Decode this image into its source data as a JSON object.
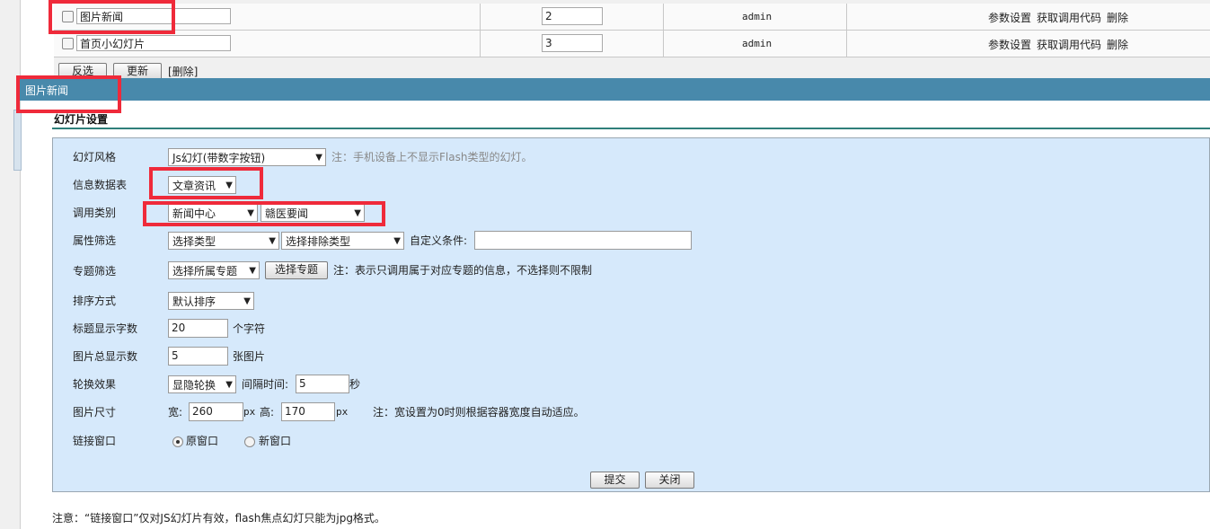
{
  "top_table": {
    "rows": [
      {
        "name": "图片新闻",
        "order": "2",
        "author": "admin",
        "actions": [
          "参数设置",
          "获取调用代码",
          "删除"
        ]
      },
      {
        "name": "首页小幻灯片",
        "order": "3",
        "author": "admin",
        "actions": [
          "参数设置",
          "获取调用代码",
          "删除"
        ]
      }
    ],
    "buttons": {
      "invert": "反选",
      "update": "更新",
      "delete": "[删除]"
    }
  },
  "header_band": {
    "title": "图片新闻"
  },
  "section": {
    "title": "幻灯片设置"
  },
  "form": {
    "style": {
      "label": "幻灯风格",
      "value": "Js幻灯(带数字按钮)",
      "note": "注：手机设备上不显示Flash类型的幻灯。"
    },
    "table": {
      "label": "信息数据表",
      "value": "文章资讯"
    },
    "category": {
      "label": "调用类别",
      "value1": "新闻中心",
      "value2": "赣医要闻"
    },
    "attribute": {
      "label": "属性筛选",
      "type": "选择类型",
      "exclude": "选择排除类型",
      "custom_label": "自定义条件:",
      "custom_value": ""
    },
    "topic": {
      "label": "专题筛选",
      "select": "选择所属专题",
      "button": "选择专题",
      "note": "注：表示只调用属于对应专题的信息，不选择则不限制"
    },
    "sort": {
      "label": "排序方式",
      "value": "默认排序"
    },
    "title_len": {
      "label": "标题显示字数",
      "value": "20",
      "unit": "个字符"
    },
    "pic_count": {
      "label": "图片总显示数",
      "value": "5",
      "unit": "张图片"
    },
    "effect": {
      "label": "轮换效果",
      "value": "显隐轮换",
      "interval_label": "间隔时间:",
      "interval_value": "5",
      "interval_unit": "秒"
    },
    "size": {
      "label": "图片尺寸",
      "width_label": "宽:",
      "width": "260",
      "px1": "px",
      "height_label": "高:",
      "height": "170",
      "px2": "px",
      "note": "注：宽设置为0时则根据容器宽度自动适应。"
    },
    "link": {
      "label": "链接窗口",
      "opt1": "原窗口",
      "opt2": "新窗口"
    },
    "submit": "提交",
    "close": "关闭"
  },
  "footer_note": "注意：“链接窗口”仅对JS幻灯片有效，flash焦点幻灯只能为jpg格式。",
  "colors": {
    "band": "#4889ab",
    "panel": "#d6e9fb",
    "highlight": "#ef2a3a"
  }
}
